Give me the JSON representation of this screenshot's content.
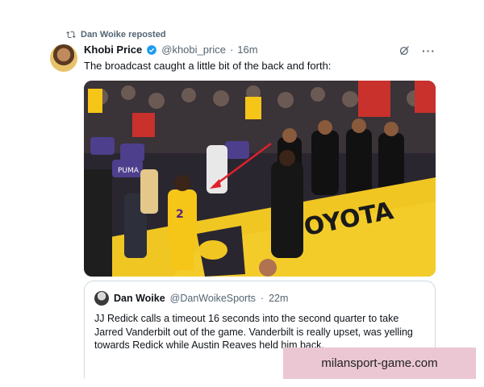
{
  "repost": {
    "label": "Dan Woike reposted",
    "icon": "repost-icon"
  },
  "tweet": {
    "author_name": "Khobi Price",
    "handle": "@khobi_price",
    "separator": "·",
    "time": "16m",
    "text": "The broadcast caught a little bit of the back and forth:",
    "verified_color": "#1d9bf0"
  },
  "media": {
    "court_text": "TOYOTA",
    "seat_banner": "PUMA",
    "jersey_number": "2"
  },
  "quote": {
    "author_name": "Dan Woike",
    "handle": "@DanWoikeSports",
    "separator": "·",
    "time": "22m",
    "text": "JJ Redick calls a timeout 16 seconds into the second quarter to take Jarred Vanderbilt out of the game. Vanderbilt is really upset, was yelling towards Redick while Austin Reaves held him back."
  },
  "watermark": {
    "text": "milansport-game.com"
  },
  "colors": {
    "accent": "#1d9bf0",
    "muted": "#536471",
    "lakers_gold": "#f5c518",
    "lakers_purple": "#552583"
  }
}
